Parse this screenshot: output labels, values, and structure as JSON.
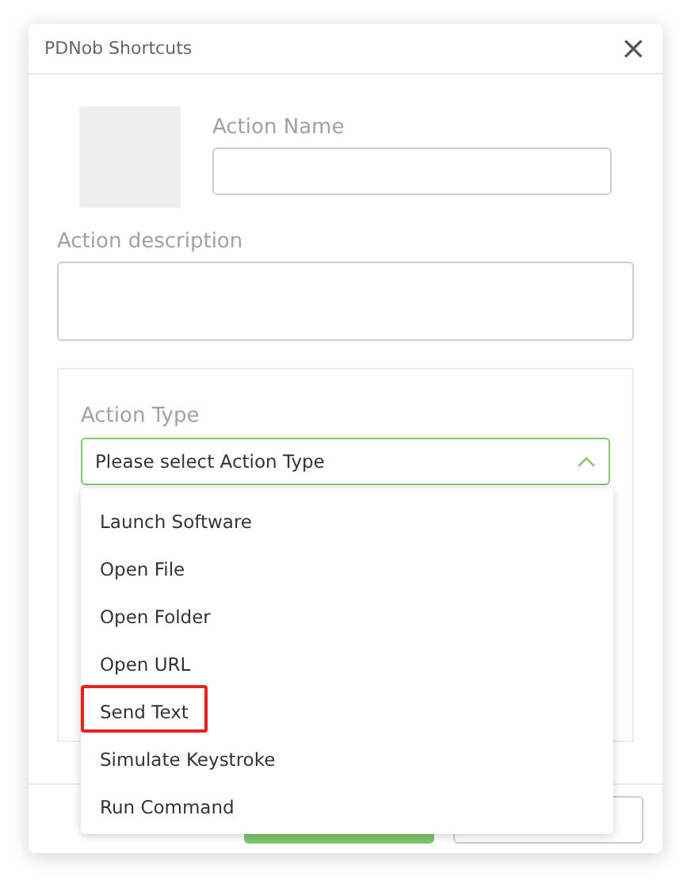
{
  "window": {
    "title": "PDNob Shortcuts",
    "close": "×"
  },
  "action_name": {
    "label": "Action Name"
  },
  "action_description": {
    "label": "Action description"
  },
  "action_type": {
    "label": "Action Type",
    "placeholder": "Please select Action Type",
    "expanded": true,
    "options": [
      {
        "label": "Launch Software",
        "highlighted": false
      },
      {
        "label": "Open File",
        "highlighted": false
      },
      {
        "label": "Open Folder",
        "highlighted": false
      },
      {
        "label": "Open URL",
        "highlighted": false
      },
      {
        "label": "Send Text",
        "highlighted": true
      },
      {
        "label": "Simulate Keystroke",
        "highlighted": false
      },
      {
        "label": "Run Command",
        "highlighted": false
      }
    ]
  }
}
